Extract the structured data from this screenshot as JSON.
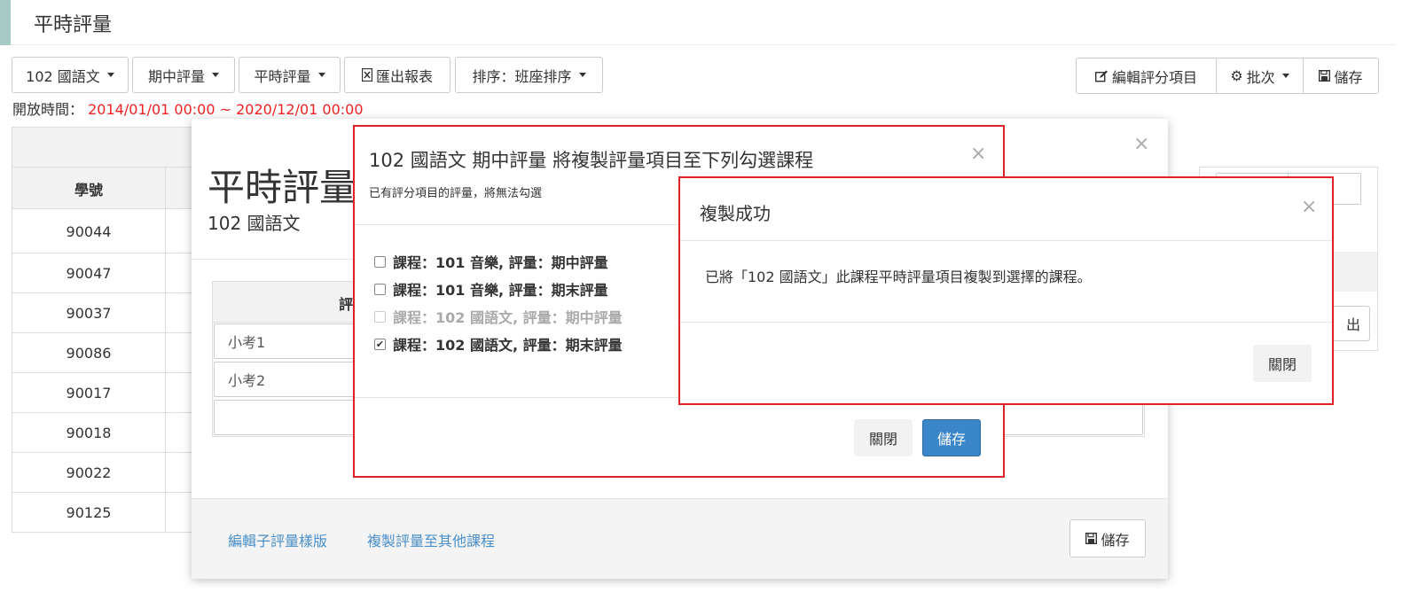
{
  "header": {
    "title": "平時評量"
  },
  "toolbar": {
    "course": "102 國語文",
    "midterm": "期中評量",
    "regular": "平時評量",
    "export": "匯出報表",
    "sort": "排序：班座排序",
    "edit_items": "編輯評分項目",
    "batch": "批次",
    "save": "儲存"
  },
  "open_time": {
    "label": "開放時間：",
    "range": "2014/01/01 00:00 ~ 2020/12/01 00:00"
  },
  "table": {
    "column": "學號",
    "rows": [
      "90044",
      "90047",
      "90037",
      "90086",
      "90017",
      "90018",
      "90022",
      "90125"
    ],
    "export_fragment": "出"
  },
  "regular_modal": {
    "title": "平時評量",
    "subtitle": "102 國語文",
    "close": "×",
    "column_fragment": "評",
    "items": [
      "小考1",
      "小考2"
    ],
    "edit_template_link": "編輯子評量樣版",
    "copy_link": "複製評量至其他課程",
    "save": "儲存"
  },
  "copy_modal": {
    "title": "102 國語文 期中評量 將複製評量項目至下列勾選課程",
    "note": "已有評分項目的評量，將無法勾選",
    "close": "×",
    "options": [
      {
        "label": "課程：101 音樂, 評量：期中評量",
        "checked": false,
        "disabled": false
      },
      {
        "label": "課程：101 音樂, 評量：期末評量",
        "checked": false,
        "disabled": false
      },
      {
        "label": "課程：102 國語文, 評量：期中評量",
        "checked": false,
        "disabled": true
      },
      {
        "label": "課程：102 國語文, 評量：期末評量",
        "checked": true,
        "disabled": false
      }
    ],
    "close_btn": "關閉",
    "save_btn": "儲存"
  },
  "success_modal": {
    "title": "複製成功",
    "close": "×",
    "message": "已將「102 國語文」此課程平時評量項目複製到選擇的課程。",
    "close_btn": "關閉"
  },
  "colors": {
    "accent": "#a6cbc6",
    "danger": "#e0212b",
    "primary": "#3a86c8",
    "link": "#4a8fc9"
  }
}
